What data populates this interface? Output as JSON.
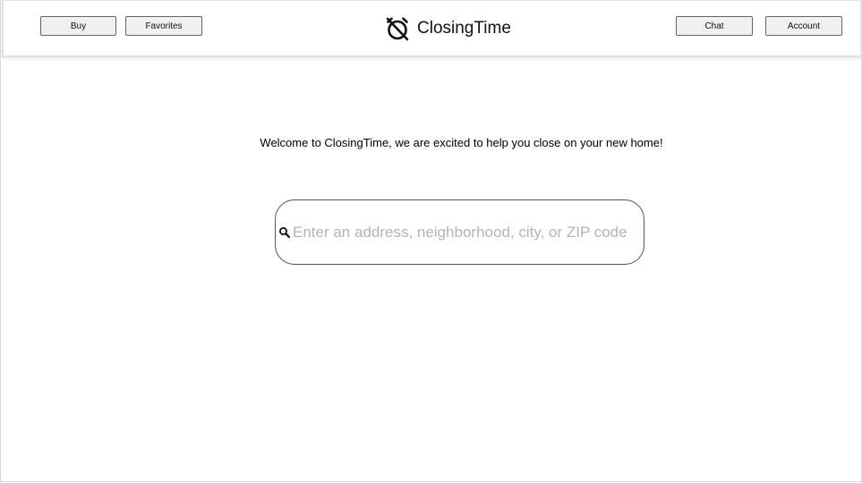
{
  "header": {
    "buttons_left": [
      {
        "label": "Buy"
      },
      {
        "label": "Favorites"
      }
    ],
    "brand": {
      "name": "ClosingTime",
      "icon": "alarm-clock-off-icon"
    },
    "buttons_right": [
      {
        "label": "Chat"
      },
      {
        "label": "Account"
      }
    ]
  },
  "main": {
    "welcome_text": "Welcome to ClosingTime, we are excited to help you close on your new home!",
    "search": {
      "icon": "search-icon",
      "value": "",
      "placeholder": "Enter an address, neighborhood, city, or ZIP code"
    }
  },
  "colors": {
    "button_bg": "#f0f0f0",
    "button_border": "#666666",
    "placeholder": "#b4b4b4",
    "header_border": "#e2e2e2"
  }
}
